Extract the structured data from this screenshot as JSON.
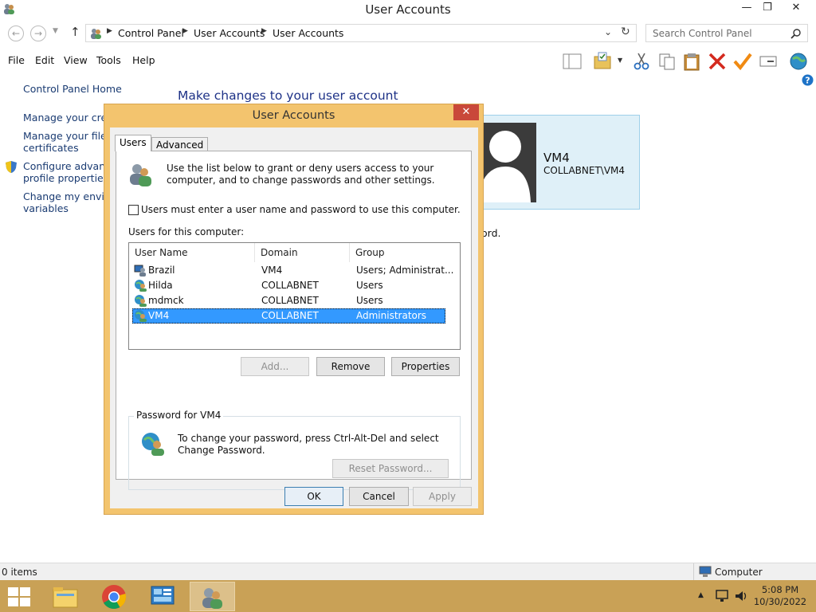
{
  "window": {
    "title": "User Accounts"
  },
  "address": {
    "crumbs": [
      "Control Panel",
      "User Accounts",
      "User Accounts"
    ],
    "search_placeholder": "Search Control Panel"
  },
  "menu": {
    "items": [
      "File",
      "Edit",
      "View",
      "Tools",
      "Help"
    ]
  },
  "leftnav": {
    "home": "Control Panel Home",
    "links": [
      [
        "Manage your crede"
      ],
      [
        "Manage your file er",
        "certificates"
      ],
      [
        "Configure advance",
        "profile properties"
      ],
      [
        "Change my environ",
        "variables"
      ]
    ]
  },
  "main": {
    "heading": "Make changes to your user account",
    "account_name": "VM4",
    "account_domain": "COLLABNET\\VM4",
    "partial_text": "ord."
  },
  "dialog": {
    "title": "User Accounts",
    "tabs": [
      "Users",
      "Advanced"
    ],
    "intro": "Use the list below to grant or deny users access to your computer, and to change passwords and other settings.",
    "checkbox_label": "Users must enter a user name and password to use this computer.",
    "checkbox_checked": false,
    "list_label": "Users for this computer:",
    "columns": [
      "User Name",
      "Domain",
      "Group"
    ],
    "users": [
      {
        "name": "Brazil",
        "domain": "VM4",
        "group": "Users; Administrat...",
        "selected": false
      },
      {
        "name": "Hilda",
        "domain": "COLLABNET",
        "group": "Users",
        "selected": false
      },
      {
        "name": "mdmck",
        "domain": "COLLABNET",
        "group": "Users",
        "selected": false
      },
      {
        "name": "VM4",
        "domain": "COLLABNET",
        "group": "Administrators",
        "selected": true
      }
    ],
    "buttons": {
      "add": "Add...",
      "remove": "Remove",
      "properties": "Properties"
    },
    "password_group": "Password for VM4",
    "password_text": "To change your password, press Ctrl-Alt-Del and select Change Password.",
    "reset_password": "Reset Password...",
    "ok": "OK",
    "cancel": "Cancel",
    "apply": "Apply"
  },
  "status": {
    "items": "0 items",
    "location": "Computer"
  },
  "taskbar": {
    "time": "5:08 PM",
    "date": "10/30/2022"
  },
  "colors": {
    "dialog_frame": "#f3c46e",
    "taskbar": "#c9a156",
    "selection": "#3399ff",
    "link": "#1a3b72",
    "heading": "#1e3287"
  }
}
